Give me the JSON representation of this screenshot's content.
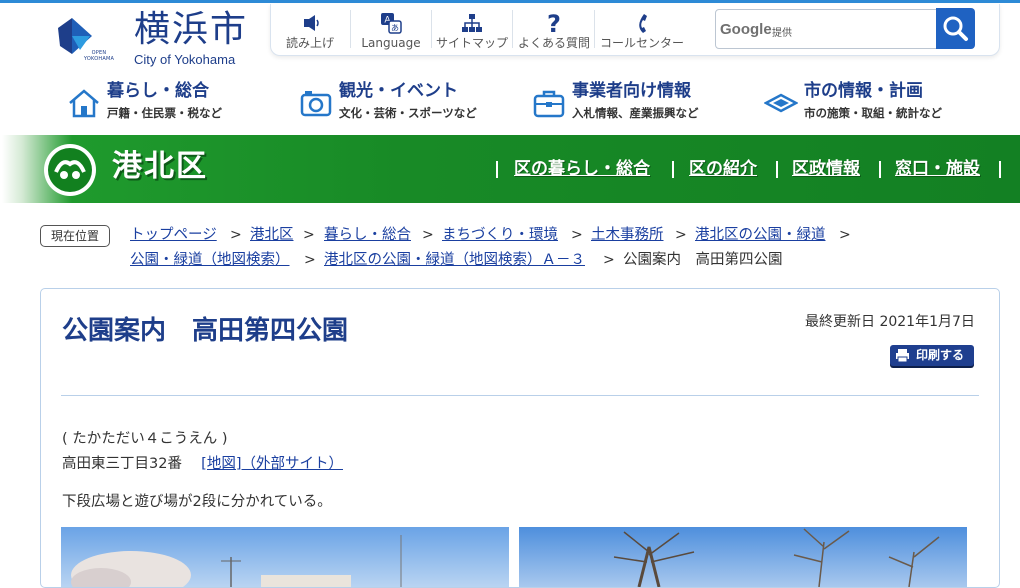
{
  "site": {
    "logo_kanji": "横浜市",
    "logo_english": "City of Yokohama",
    "logo_open": "OPEN YOKOHAMA"
  },
  "utility": {
    "items": [
      {
        "label": "読み上げ",
        "icon": "speaker-icon"
      },
      {
        "label": "Language",
        "icon": "language-icon"
      },
      {
        "label": "サイトマップ",
        "icon": "sitemap-icon"
      },
      {
        "label": "よくある質問",
        "icon": "question-icon"
      },
      {
        "label": "コールセンター",
        "icon": "phone-icon"
      }
    ]
  },
  "search": {
    "google_label": "Google",
    "provided_label": "提供",
    "button_icon": "search-icon"
  },
  "global_nav": [
    {
      "title": "暮らし・総合",
      "sub": "戸籍・住民票・税など",
      "icon": "house-icon"
    },
    {
      "title": "観光・イベント",
      "sub": "文化・芸術・スポーツなど",
      "icon": "camera-icon"
    },
    {
      "title": "事業者向け情報",
      "sub": "入札情報、産業振興など",
      "icon": "briefcase-icon"
    },
    {
      "title": "市の情報・計画",
      "sub": "市の施策・取組・統計など",
      "icon": "city-emblem-icon"
    }
  ],
  "ward": {
    "name": "港北区",
    "nav": [
      "区の暮らし・総合",
      "区の紹介",
      "区政情報",
      "窓口・施設"
    ]
  },
  "breadcrumb": {
    "label": "現在位置",
    "items": [
      "トップページ",
      "港北区",
      "暮らし・総合",
      "まちづくり・環境",
      "土木事務所",
      "港北区の公園・緑道",
      "公園・緑道（地図検索）",
      "港北区の公園・緑道（地図検索）Ａ－３"
    ],
    "current": "公園案内　高田第四公園",
    "separator": ">"
  },
  "article": {
    "title": "公園案内　高田第四公園",
    "updated": "最終更新日 2021年1月7日",
    "print_label": "印刷する",
    "reading": "( たかただい４こうえん )",
    "address": "高田東三丁目32番",
    "map_link": "[地図]（外部サイト）",
    "description": "下段広場と遊び場が2段に分かれている。"
  },
  "colors": {
    "brand_blue": "#1e3e8a",
    "ward_green": "#188a26",
    "link_blue": "#1a3fa0",
    "search_blue": "#1f62c2"
  }
}
